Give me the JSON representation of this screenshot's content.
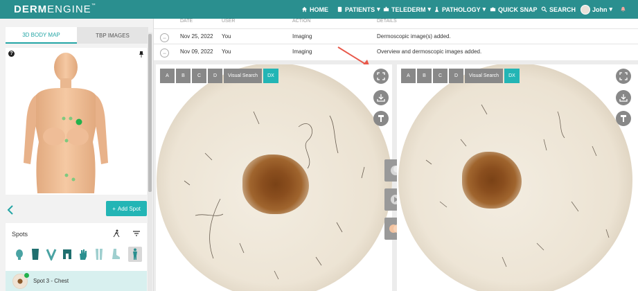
{
  "app": {
    "brand_bold": "DERM",
    "brand_light": "ENGINE",
    "brand_tm": "™"
  },
  "nav": {
    "home": "HOME",
    "patients": "PATIENTS",
    "telederm": "TELEDERM",
    "pathology": "PATHOLOGY",
    "quick_snap": "QUICK SNAP",
    "search": "SEARCH",
    "user": "John"
  },
  "left": {
    "tab_body_map": "3D BODY MAP",
    "tab_tbp": "TBP IMAGES",
    "help": "?",
    "add_spot": "Add Spot",
    "spots_title": "Spots",
    "spot_label": "Spot 3 - Chest"
  },
  "history": {
    "headers": [
      "DATE",
      "USER",
      "ACTION",
      "DETAILS"
    ],
    "rows": [
      {
        "date": "Nov 25, 2022",
        "user": "You",
        "action": "Imaging",
        "details": "Dermoscopic image(s) added."
      },
      {
        "date": "Nov 09, 2022",
        "user": "You",
        "action": "Imaging",
        "details": "Overview and dermoscopic images added."
      }
    ]
  },
  "viewer": {
    "btn_a": "A",
    "btn_b": "B",
    "btn_c": "C",
    "btn_d": "D",
    "visual_search": "Visual Search",
    "dx": "DX"
  },
  "colors": {
    "navbar": "#2a8f8f",
    "accent": "#23b5b5",
    "marker_green": "#22b14c",
    "annotation_arrow": "#e8584a"
  },
  "icons": {
    "nav": [
      "home-icon",
      "patients-icon",
      "telederm-icon",
      "pathology-icon",
      "camera-icon",
      "search-icon",
      "bell-icon"
    ],
    "viewer": [
      "fullscreen-icon",
      "download-icon",
      "brush-icon"
    ],
    "side": [
      "overlay-icon",
      "play-icon",
      "compare-icon"
    ]
  }
}
